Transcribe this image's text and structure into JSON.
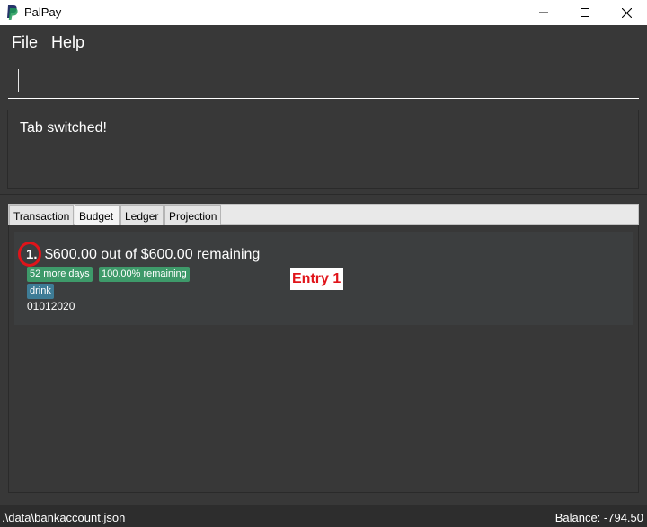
{
  "window": {
    "title": "PalPay",
    "logo_icon": "paypal-logo-icon",
    "brand_color": "#3b7bbf"
  },
  "menu": {
    "file_label": "File",
    "help_label": "Help"
  },
  "command": {
    "value": ""
  },
  "result": {
    "message": "Tab switched!"
  },
  "tabs": [
    {
      "label": "Transaction",
      "selected": false
    },
    {
      "label": "Budget",
      "selected": true
    },
    {
      "label": "Ledger",
      "selected": false
    },
    {
      "label": "Projection",
      "selected": false
    }
  ],
  "budgets": [
    {
      "index": "1.",
      "amount_text": "$600.00 out of $600.00 remaining",
      "days_tag": "52 more days",
      "percent_tag": "100.00% remaining",
      "category_tag": "drink",
      "date": "01012020"
    }
  ],
  "annotation": {
    "label": "Entry 1",
    "color": "#e0141a"
  },
  "status": {
    "path": ".\\data\\bankaccount.json",
    "balance": "Balance: -794.50"
  }
}
